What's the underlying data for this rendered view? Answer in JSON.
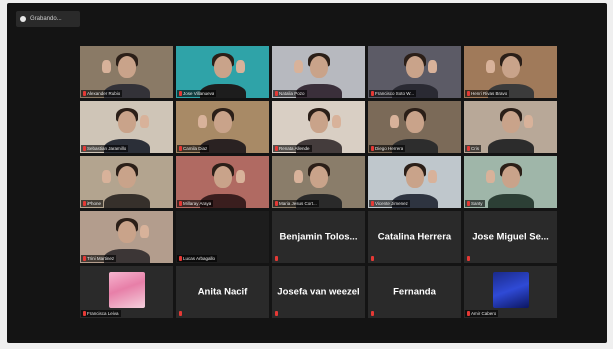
{
  "recording": {
    "label": "Grabando..."
  },
  "colors": {
    "window_bg": "#141414",
    "tile_bg": "#2a2a2a",
    "active_speaker": "#d6e03a",
    "muted_mic": "#e53935"
  },
  "participants": [
    {
      "name": "Alexander Rubio",
      "video": true,
      "speaking": true,
      "bg": "#8a7a66",
      "shirt": "#333238"
    },
    {
      "name": "Jose Villanueva",
      "video": true,
      "bg": "#2fa3a8",
      "shirt": "#1d1d1d"
    },
    {
      "name": "Natalia Pozo",
      "video": true,
      "bg": "#b7b9bf",
      "shirt": "#3a2f3a"
    },
    {
      "name": "Francisco Soto W...",
      "video": true,
      "bg": "#5c5b66",
      "shirt": "#2a2a33"
    },
    {
      "name": "Henri Rivas Bravo",
      "video": true,
      "bg": "#a07a5a",
      "shirt": "#3b3b3b"
    },
    {
      "name": "Sebastian Jaramillo",
      "video": true,
      "bg": "#cfc5b7",
      "shirt": "#2b2f38"
    },
    {
      "name": "Camila Diaz",
      "video": true,
      "bg": "#a88a66",
      "shirt": "#2a2222"
    },
    {
      "name": "Renata Allende",
      "video": true,
      "bg": "#d9cfc4",
      "shirt": "#443c3c"
    },
    {
      "name": "Diego Herrera",
      "video": true,
      "bg": "#7b6a58",
      "shirt": "#2d2d2d"
    },
    {
      "name": "Cris",
      "video": true,
      "bg": "#b8a898",
      "shirt": "#2c2c2c"
    },
    {
      "name": "iPhone",
      "video": true,
      "bg": "#b3a48f",
      "shirt": "#36302b"
    },
    {
      "name": "Millaray Araya",
      "video": true,
      "bg": "#b06a62",
      "shirt": "#3a1e1e"
    },
    {
      "name": "Maria Jesus Cort...",
      "video": true,
      "bg": "#8a7d6a",
      "shirt": "#2a2a2a"
    },
    {
      "name": "Vicente Jimenez",
      "video": true,
      "bg": "#bfc7cc",
      "shirt": "#2e3440"
    },
    {
      "name": "Santy",
      "video": true,
      "bg": "#9fb6a9",
      "shirt": "#2c3f35"
    },
    {
      "name": "Trini Martinez",
      "video": true,
      "bg": "#b39d8d",
      "shirt": "#3c3636"
    },
    {
      "name": "Lucas Arbagallo",
      "video": false,
      "dark": true,
      "big": ""
    },
    {
      "name": "",
      "video": false,
      "big": "Benjamin Tolos..."
    },
    {
      "name": "",
      "video": false,
      "big": "Catalina Herrera"
    },
    {
      "name": "",
      "video": false,
      "big": "Jose Miguel Se..."
    },
    {
      "name": "Francisca Leiva",
      "video": false,
      "avatar": "pink"
    },
    {
      "name": "",
      "video": false,
      "big": "Anita Nacif"
    },
    {
      "name": "",
      "video": false,
      "big": "Josefa van weezel"
    },
    {
      "name": "",
      "video": false,
      "big": "Fernanda"
    },
    {
      "name": "Amir Cabero",
      "video": false,
      "avatar": "blue"
    }
  ]
}
